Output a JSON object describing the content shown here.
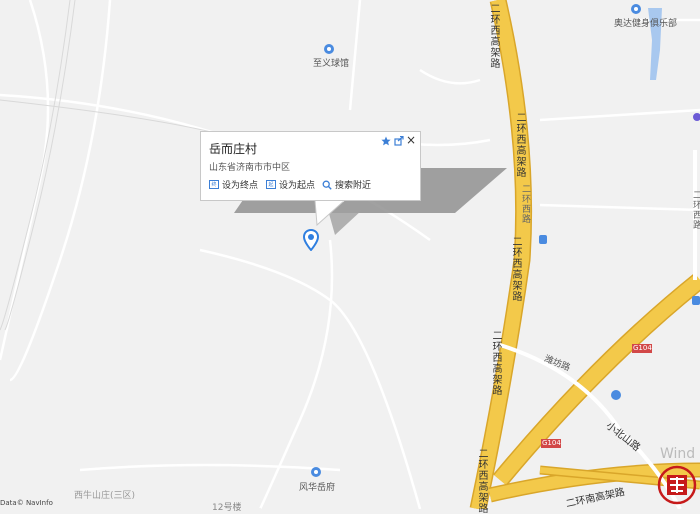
{
  "popup": {
    "title": "岳而庄村",
    "address": "山东省济南市市中区",
    "actions": [
      {
        "icon": "终",
        "label": "设为终点"
      },
      {
        "icon": "起",
        "label": "设为起点"
      },
      {
        "icon": "search-icon",
        "label": "搜索附近"
      }
    ],
    "close": "×"
  },
  "pois": {
    "shengyi": "至义球馆",
    "aoda": "奥达健身俱乐部",
    "fenghua": "风华岳府",
    "xiniushan": "西牛山庄(三区)",
    "no12": "12号楼"
  },
  "roads": {
    "ring_west_viaduct": "二环西高架路",
    "ring_west_viaduct_2": "二环西高架路",
    "ring_west_viaduct_3": "二环西高架路",
    "ring_west": "二环西路",
    "ring_west_right": "二环西路",
    "ring_south_viaduct": "二环南高架路",
    "weifang": "潍坊路",
    "xiaobeishan": "小北山路",
    "g104a": "G104",
    "g104b": "G104"
  },
  "watermark": "Wind",
  "copyright": "Data© NavInfo",
  "colors": {
    "background": "#f1f1f1",
    "highway_fill": "#f3c94a",
    "highway_edge": "#d9a62a",
    "water": "#a8c8ef",
    "pin": "#2f7fe0",
    "stamp": "#c61a1a"
  }
}
